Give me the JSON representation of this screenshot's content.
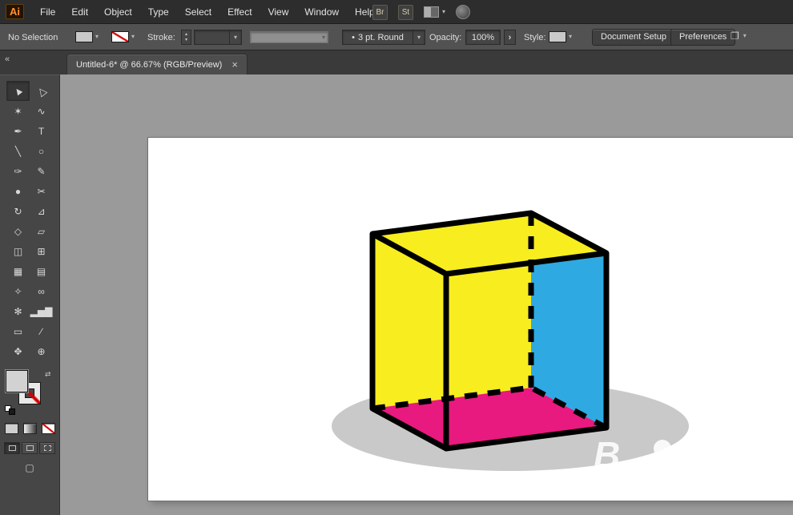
{
  "menu_bar": {
    "logo": "Ai",
    "items": [
      "File",
      "Edit",
      "Object",
      "Type",
      "Select",
      "Effect",
      "View",
      "Window",
      "Help"
    ],
    "bridge_label": "Br",
    "stock_label": "St",
    "caret": "▾"
  },
  "control_bar": {
    "selection_status": "No Selection",
    "stroke_label": "Stroke:",
    "stepper_up": "▴",
    "stepper_down": "▾",
    "caret": "▾",
    "stroke_value": "",
    "brush_dot": "•",
    "brush_name": "3 pt. Round",
    "opacity_label": "Opacity:",
    "opacity_value": "100%",
    "flyout_arrow": "›",
    "style_label": "Style:",
    "document_setup_label": "Document Setup",
    "preferences_label": "Preferences",
    "panel_options_glyph": "❐"
  },
  "tab_bar": {
    "collapse_glyph": "«",
    "tab_title": "Untitled-6* @ 66.67% (RGB/Preview)",
    "close_glyph": "×"
  },
  "toolbar": {
    "tools": [
      {
        "name": "selection-tool",
        "glyph": "▲",
        "selected": true,
        "rotate": true
      },
      {
        "name": "direct-selection-tool",
        "glyph": "△",
        "rotate": true
      },
      {
        "name": "magic-wand-tool",
        "glyph": "✶"
      },
      {
        "name": "lasso-tool",
        "glyph": "∿"
      },
      {
        "name": "pen-tool",
        "glyph": "✒"
      },
      {
        "name": "type-tool",
        "glyph": "T"
      },
      {
        "name": "line-segment-tool",
        "glyph": "╲"
      },
      {
        "name": "ellipse-tool",
        "glyph": "○"
      },
      {
        "name": "paintbrush-tool",
        "glyph": "✑"
      },
      {
        "name": "pencil-tool",
        "glyph": "✎"
      },
      {
        "name": "blob-brush-tool",
        "glyph": "●"
      },
      {
        "name": "scissors-tool",
        "glyph": "✂"
      },
      {
        "name": "rotate-tool",
        "glyph": "↻"
      },
      {
        "name": "scale-tool",
        "glyph": "⊿"
      },
      {
        "name": "width-tool",
        "glyph": "◇"
      },
      {
        "name": "free-transform-tool",
        "glyph": "▱"
      },
      {
        "name": "shape-builder-tool",
        "glyph": "◫"
      },
      {
        "name": "perspective-grid-tool",
        "glyph": "⊞"
      },
      {
        "name": "mesh-tool",
        "glyph": "▦"
      },
      {
        "name": "gradient-tool",
        "glyph": "▤"
      },
      {
        "name": "eyedropper-tool",
        "glyph": "✧"
      },
      {
        "name": "blend-tool",
        "glyph": "∞"
      },
      {
        "name": "symbol-sprayer-tool",
        "glyph": "✻"
      },
      {
        "name": "column-graph-tool",
        "glyph": "▂▅▇"
      },
      {
        "name": "artboard-tool",
        "glyph": "▭"
      },
      {
        "name": "slice-tool",
        "glyph": "∕"
      },
      {
        "name": "hand-tool",
        "glyph": "✥"
      },
      {
        "name": "zoom-tool",
        "glyph": "⊕"
      }
    ],
    "swap_glyph": "⇄",
    "screen_mode_glyph": "▢"
  },
  "artwork": {
    "colors": {
      "top_face": "#f8ed1e",
      "left_face": "#f8ed1e",
      "right_face": "#2fa9e1",
      "bottom_face": "#e8197f",
      "shadow": "#c9c9c9",
      "outline": "#000000",
      "watermark": "#ffffff"
    },
    "watermark_text": "B"
  }
}
